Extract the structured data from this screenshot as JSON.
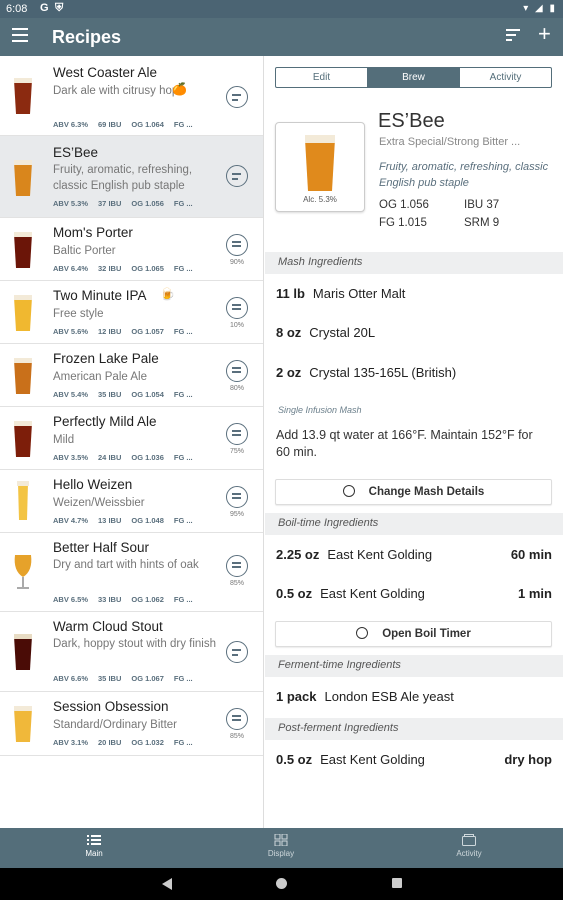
{
  "status": {
    "time": "6:08",
    "icons": [
      "G",
      "⛨"
    ],
    "right": "▾ ◢ ▮"
  },
  "appbar": {
    "title": "Recipes",
    "menu_icon": "menu-icon",
    "sort_icon": "sort-icon",
    "add_icon": "+"
  },
  "recipes": [
    {
      "name": "West Coaster Ale",
      "emoji": "🍊",
      "desc": "Dark ale with citrusy hops",
      "abv": "ABV 6.3%",
      "ibu": "69 IBU",
      "og": "OG 1.064",
      "fg": "FG ...",
      "pct": "",
      "color": "#8b2a10"
    },
    {
      "name": "ES’Bee",
      "emoji": "",
      "desc": "Fruity, aromatic, refreshing, classic English pub staple",
      "abv": "ABV 5.3%",
      "ibu": "37 IBU",
      "og": "OG 1.056",
      "fg": "FG ...",
      "pct": "",
      "color": "#d9861c"
    },
    {
      "name": "Mom's Porter",
      "emoji": "",
      "desc": "Baltic Porter",
      "abv": "ABV 6.4%",
      "ibu": "32 IBU",
      "og": "OG 1.065",
      "fg": "FG ...",
      "pct": "90%",
      "color": "#6b1508"
    },
    {
      "name": "Two Minute IPA",
      "emoji": "🍺",
      "desc": "Free style",
      "abv": "ABV 5.6%",
      "ibu": "12 IBU",
      "og": "OG 1.057",
      "fg": "FG ...",
      "pct": "10%",
      "color": "#f0b830"
    },
    {
      "name": "Frozen Lake Pale",
      "emoji": "",
      "desc": "American Pale Ale",
      "abv": "ABV 5.4%",
      "ibu": "35 IBU",
      "og": "OG 1.054",
      "fg": "FG ...",
      "pct": "80%",
      "color": "#c9701a"
    },
    {
      "name": "Perfectly Mild Ale",
      "emoji": "",
      "desc": "Mild",
      "abv": "ABV 3.5%",
      "ibu": "24 IBU",
      "og": "OG 1.036",
      "fg": "FG ...",
      "pct": "75%",
      "color": "#7d1e0a"
    },
    {
      "name": "Hello Weizen",
      "emoji": "",
      "desc": "Weizen/Weissbier",
      "abv": "ABV 4.7%",
      "ibu": "13 IBU",
      "og": "OG 1.048",
      "fg": "FG ...",
      "pct": "95%",
      "color": "#f3c444"
    },
    {
      "name": "Better Half Sour",
      "emoji": "",
      "desc": "Dry and tart with hints of oak",
      "abv": "ABV 6.5%",
      "ibu": "33 IBU",
      "og": "OG 1.062",
      "fg": "FG ...",
      "pct": "85%",
      "color": "#e6a22a"
    },
    {
      "name": "Warm Cloud Stout",
      "emoji": "",
      "desc": "Dark, hoppy stout with dry finish",
      "abv": "ABV 6.6%",
      "ibu": "35 IBU",
      "og": "OG 1.067",
      "fg": "FG ...",
      "pct": "",
      "color": "#4a0c06"
    },
    {
      "name": "Session Obsession",
      "emoji": "",
      "desc": "Standard/Ordinary Bitter",
      "abv": "ABV 3.1%",
      "ibu": "20 IBU",
      "og": "OG 1.032",
      "fg": "FG ...",
      "pct": "85%",
      "color": "#f0b83a"
    }
  ],
  "detail": {
    "tabs": [
      "Edit",
      "Brew",
      "Activity"
    ],
    "title": "ES’Bee",
    "style": "Extra Special/Strong Bitter ...",
    "tagline": "Fruity, aromatic, refreshing, classic English pub staple",
    "abv": "Alc. 5.3%",
    "og": "OG 1.056",
    "ibu": "IBU 37",
    "fg": "FG 1.015",
    "srm": "SRM 9",
    "mash_header": "Mash Ingredients",
    "mash": [
      {
        "amount": "11 lb",
        "name": "Maris Otter Malt"
      },
      {
        "amount": "8 oz",
        "name": "Crystal 20L"
      },
      {
        "amount": "2 oz",
        "name": "Crystal 135-165L (British)"
      }
    ],
    "mash_type": "Single Infusion Mash",
    "mash_step": "Add 13.9 qt water at 166°F. Maintain 152°F for 60 min.",
    "mash_button": "Change Mash Details",
    "boil_header": "Boil-time Ingredients",
    "boil": [
      {
        "amount": "2.25 oz",
        "name": "East Kent Golding",
        "time": "60 min"
      },
      {
        "amount": "0.5 oz",
        "name": "East Kent Golding",
        "time": "1 min"
      }
    ],
    "boil_button": "Open Boil Timer",
    "ferment_header": "Ferment-time Ingredients",
    "ferment": [
      {
        "amount": "1 pack",
        "name": "London ESB Ale yeast"
      }
    ],
    "post_header": "Post-ferment Ingredients",
    "post": [
      {
        "amount": "0.5 oz",
        "name": "East Kent Golding",
        "time": "dry hop"
      }
    ]
  },
  "bottomnav": {
    "main": "Main",
    "display": "Display",
    "activity": "Activity"
  },
  "colors": {
    "primary": "#546e7a",
    "statusbar": "#4b6473",
    "selected_row": "#e8eaec"
  }
}
